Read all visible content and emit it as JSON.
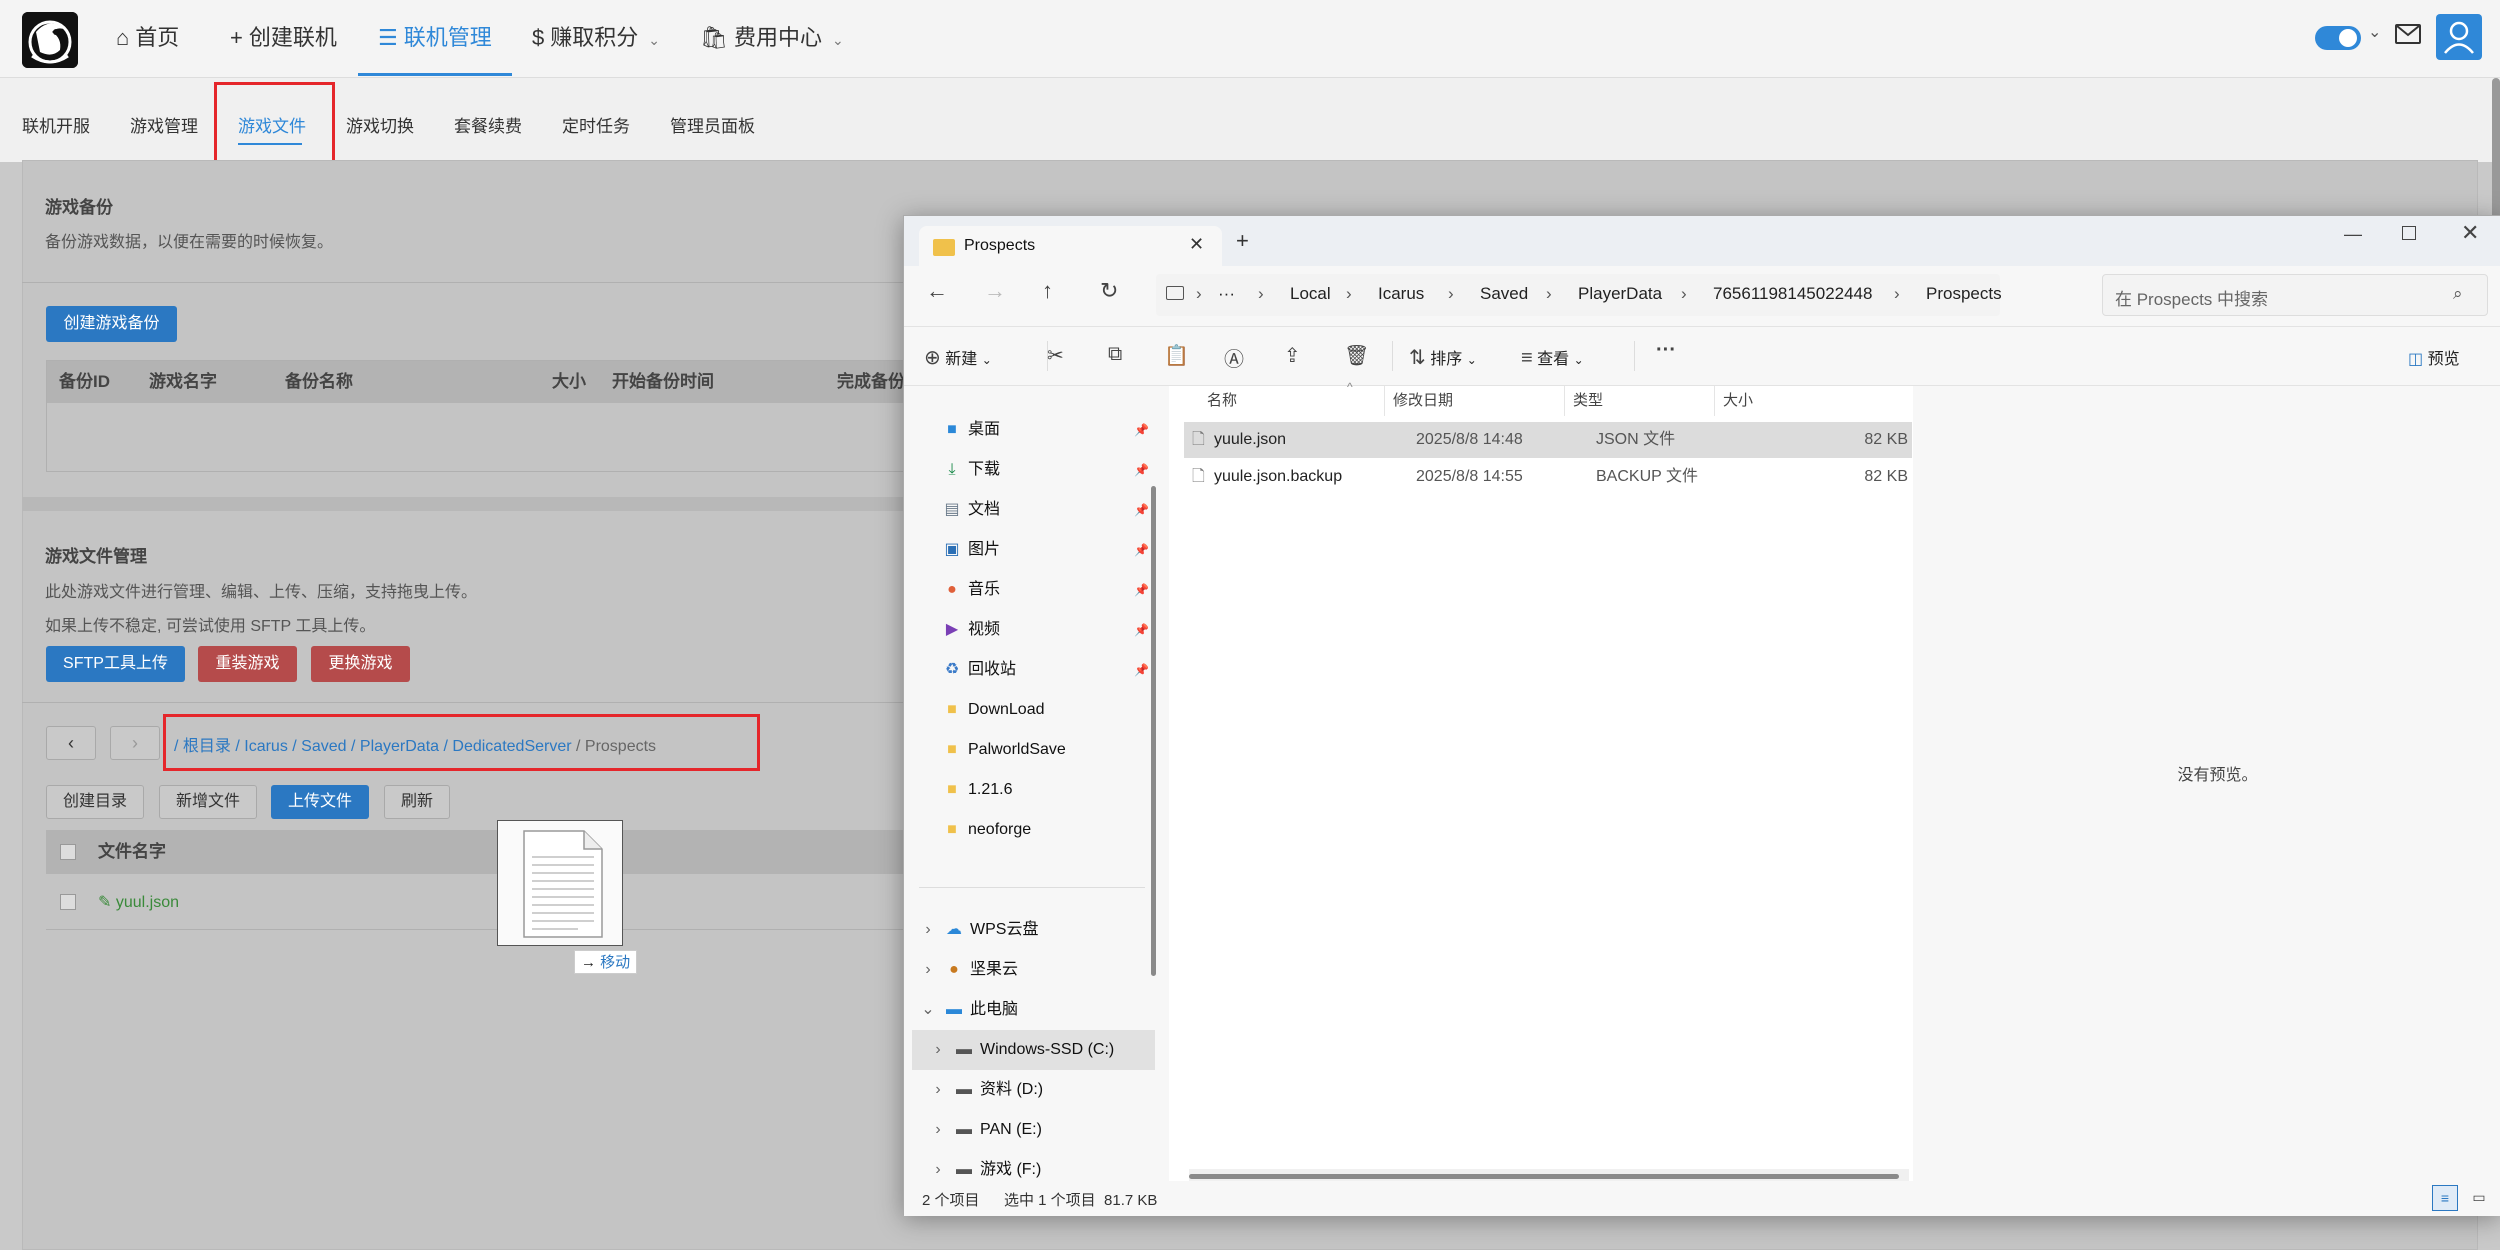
{
  "topnav": {
    "items": [
      {
        "icon": "home-icon",
        "label": "首页"
      },
      {
        "icon": "plus-icon",
        "label": "创建联机"
      },
      {
        "icon": "server-icon",
        "label": "联机管理"
      },
      {
        "icon": "dollar-icon",
        "label": "赚取积分"
      },
      {
        "icon": "bag-icon",
        "label": "费用中心"
      }
    ]
  },
  "subnav": {
    "tabs": [
      "联机开服",
      "游戏管理",
      "游戏文件",
      "游戏切换",
      "套餐续费",
      "定时任务",
      "管理员面板"
    ],
    "active": "游戏文件"
  },
  "backup": {
    "title": "游戏备份",
    "desc": "备份游戏数据，以便在需要的时候恢复。",
    "create_button": "创建游戏备份",
    "columns": [
      "备份ID",
      "游戏名字",
      "备份名称",
      "大小",
      "开始备份时间",
      "完成备份时"
    ]
  },
  "filemgr": {
    "title": "游戏文件管理",
    "desc1": "此处游戏文件进行管理、编辑、上传、压缩，支持拖曳上传。",
    "desc2": "如果上传不稳定, 可尝试使用 SFTP 工具上传。",
    "sftp_button": "SFTP工具上传",
    "reinstall_button": "重装游戏",
    "change_button": "更换游戏",
    "breadcrumb": [
      "根目录",
      "Icarus",
      "Saved",
      "PlayerData",
      "DedicatedServer",
      "Prospects"
    ],
    "actions": [
      "创建目录",
      "新增文件",
      "上传文件",
      "刷新"
    ],
    "column_name": "文件名字",
    "files": [
      "yuul.json"
    ]
  },
  "drag": {
    "label": "移动"
  },
  "explorer": {
    "tab_title": "Prospects",
    "path": [
      "Local",
      "Icarus",
      "Saved",
      "PlayerData",
      "76561198145022448",
      "Prospects"
    ],
    "search_placeholder": "在 Prospects 中搜索",
    "toolbar": {
      "new": "新建",
      "sort": "排序",
      "view": "查看",
      "preview": "预览"
    },
    "nav": {
      "quick": [
        {
          "label": "桌面",
          "icon": "desktop-icon",
          "color": "#2b88d8"
        },
        {
          "label": "下载",
          "icon": "download-icon",
          "color": "#1a8a4a"
        },
        {
          "label": "文档",
          "icon": "document-icon",
          "color": "#6a7a8a"
        },
        {
          "label": "图片",
          "icon": "picture-icon",
          "color": "#2b6fb5"
        },
        {
          "label": "音乐",
          "icon": "music-icon",
          "color": "#e0603a"
        },
        {
          "label": "视频",
          "icon": "video-icon",
          "color": "#7a3fb5"
        },
        {
          "label": "回收站",
          "icon": "recycle-bin-icon",
          "color": "#3a7ac8"
        }
      ],
      "folders": [
        "DownLoad",
        "PalworldSave",
        "1.21.6",
        "neoforge"
      ],
      "locations": [
        {
          "label": "WPS云盘",
          "icon": "cloud-icon"
        },
        {
          "label": "坚果云",
          "icon": "nut-icon"
        },
        {
          "label": "此电脑",
          "icon": "pc-icon"
        }
      ],
      "drives": [
        "Windows-SSD (C:)",
        "资料 (D:)",
        "PAN (E:)",
        "游戏 (F:)"
      ]
    },
    "columns": [
      "名称",
      "修改日期",
      "类型",
      "大小"
    ],
    "files": [
      {
        "name": "yuule.json",
        "date": "2025/8/8 14:48",
        "type": "JSON 文件",
        "size": "82 KB",
        "selected": true
      },
      {
        "name": "yuule.json.backup",
        "date": "2025/8/8 14:55",
        "type": "BACKUP 文件",
        "size": "82 KB",
        "selected": false
      }
    ],
    "no_preview": "没有预览。",
    "status_count": "2 个项目",
    "status_selected": "选中 1 个项目  81.7 KB"
  }
}
